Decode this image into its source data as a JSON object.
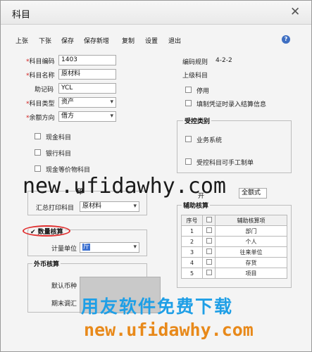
{
  "window": {
    "title": "科目",
    "close": "✕"
  },
  "toolbar": [
    "上张",
    "下张",
    "保存",
    "保存新增",
    "复制",
    "设置",
    "退出"
  ],
  "help_icon": "?",
  "form": {
    "code_label": "科目编码",
    "code_value": "1403",
    "name_label": "科目名称",
    "name_value": "原材料",
    "mnemonic_label": "助记码",
    "mnemonic_value": "YCL",
    "type_label": "科目类型",
    "type_value": "资产",
    "balance_label": "余额方向",
    "balance_value": "借方"
  },
  "right": {
    "rule_label": "编码规则",
    "rule_value": "4-2-2",
    "parent_label": "上级科目",
    "disabled_label": "停用",
    "voucher_label": "填制凭证时录入结算信息"
  },
  "checks": [
    "现金科目",
    "银行科目",
    "现金等价物科目"
  ],
  "controlled": {
    "title": "受控类别",
    "items": [
      "业务系统",
      "受控科目可手工制单"
    ]
  },
  "summary_print": {
    "title_tail": "印",
    "label": "汇总打印科目",
    "value": "原材料"
  },
  "right_mid": {
    "label": "开",
    "value": "全额式"
  },
  "quantity": {
    "title": "✔ 数量核算",
    "unit_label": "计量单位",
    "unit_value": "斤"
  },
  "foreign": {
    "title": "外币核算",
    "currency_label": "默认币种",
    "rate_label": "期末调汇"
  },
  "aux": {
    "title": "辅助核算",
    "headers": [
      "序号",
      "",
      "辅助核算项"
    ],
    "rows": [
      {
        "no": "1",
        "item": "部门"
      },
      {
        "no": "2",
        "item": "个人"
      },
      {
        "no": "3",
        "item": "往来单位"
      },
      {
        "no": "4",
        "item": "存货"
      },
      {
        "no": "5",
        "item": "项目"
      }
    ]
  },
  "watermark": {
    "url_top": "new.ufidawhy.com",
    "slogan": "用友软件免费下载",
    "url_bottom": "new.ufidawhy.com"
  }
}
